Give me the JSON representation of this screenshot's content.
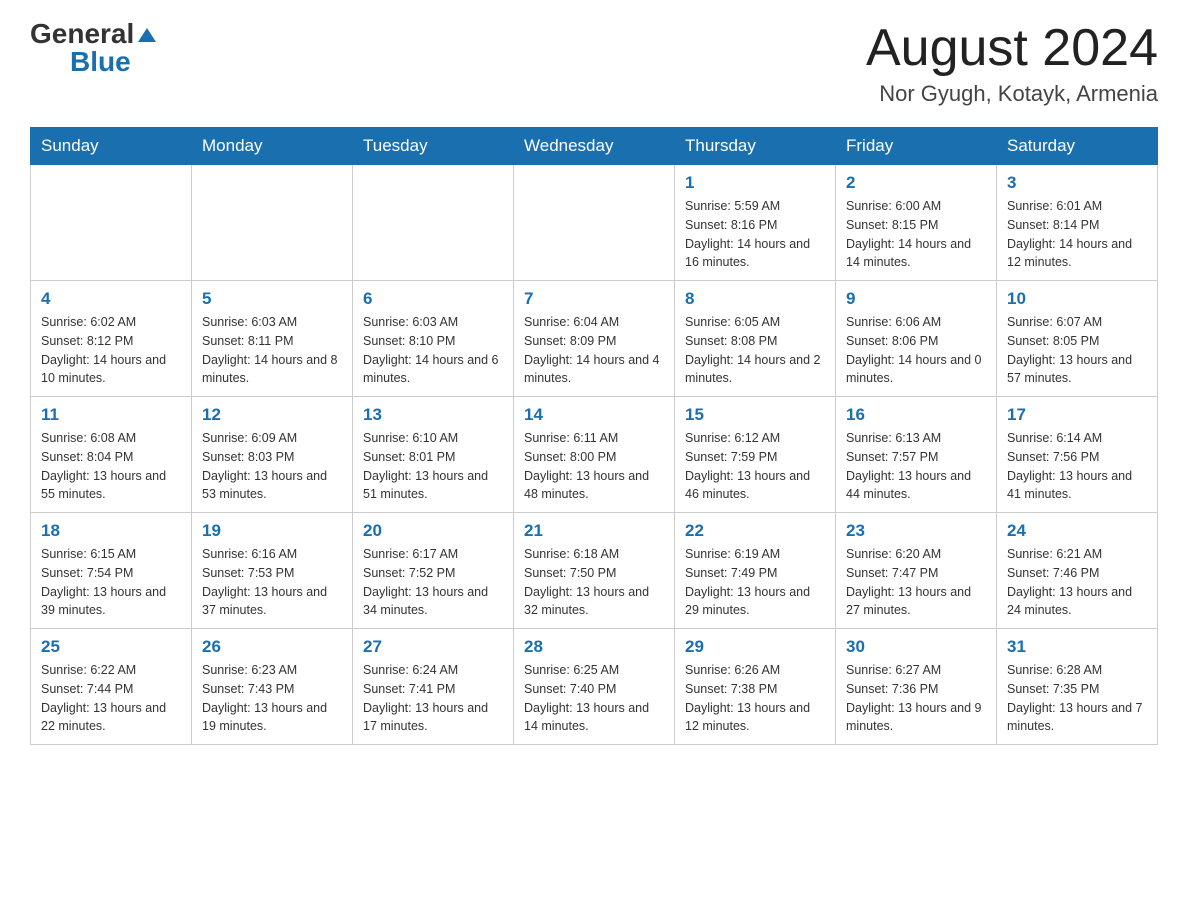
{
  "header": {
    "logo_general": "General",
    "logo_blue": "Blue",
    "month_title": "August 2024",
    "location": "Nor Gyugh, Kotayk, Armenia"
  },
  "weekdays": [
    "Sunday",
    "Monday",
    "Tuesday",
    "Wednesday",
    "Thursday",
    "Friday",
    "Saturday"
  ],
  "weeks": [
    [
      {
        "day": "",
        "info": ""
      },
      {
        "day": "",
        "info": ""
      },
      {
        "day": "",
        "info": ""
      },
      {
        "day": "",
        "info": ""
      },
      {
        "day": "1",
        "info": "Sunrise: 5:59 AM\nSunset: 8:16 PM\nDaylight: 14 hours and 16 minutes."
      },
      {
        "day": "2",
        "info": "Sunrise: 6:00 AM\nSunset: 8:15 PM\nDaylight: 14 hours and 14 minutes."
      },
      {
        "day": "3",
        "info": "Sunrise: 6:01 AM\nSunset: 8:14 PM\nDaylight: 14 hours and 12 minutes."
      }
    ],
    [
      {
        "day": "4",
        "info": "Sunrise: 6:02 AM\nSunset: 8:12 PM\nDaylight: 14 hours and 10 minutes."
      },
      {
        "day": "5",
        "info": "Sunrise: 6:03 AM\nSunset: 8:11 PM\nDaylight: 14 hours and 8 minutes."
      },
      {
        "day": "6",
        "info": "Sunrise: 6:03 AM\nSunset: 8:10 PM\nDaylight: 14 hours and 6 minutes."
      },
      {
        "day": "7",
        "info": "Sunrise: 6:04 AM\nSunset: 8:09 PM\nDaylight: 14 hours and 4 minutes."
      },
      {
        "day": "8",
        "info": "Sunrise: 6:05 AM\nSunset: 8:08 PM\nDaylight: 14 hours and 2 minutes."
      },
      {
        "day": "9",
        "info": "Sunrise: 6:06 AM\nSunset: 8:06 PM\nDaylight: 14 hours and 0 minutes."
      },
      {
        "day": "10",
        "info": "Sunrise: 6:07 AM\nSunset: 8:05 PM\nDaylight: 13 hours and 57 minutes."
      }
    ],
    [
      {
        "day": "11",
        "info": "Sunrise: 6:08 AM\nSunset: 8:04 PM\nDaylight: 13 hours and 55 minutes."
      },
      {
        "day": "12",
        "info": "Sunrise: 6:09 AM\nSunset: 8:03 PM\nDaylight: 13 hours and 53 minutes."
      },
      {
        "day": "13",
        "info": "Sunrise: 6:10 AM\nSunset: 8:01 PM\nDaylight: 13 hours and 51 minutes."
      },
      {
        "day": "14",
        "info": "Sunrise: 6:11 AM\nSunset: 8:00 PM\nDaylight: 13 hours and 48 minutes."
      },
      {
        "day": "15",
        "info": "Sunrise: 6:12 AM\nSunset: 7:59 PM\nDaylight: 13 hours and 46 minutes."
      },
      {
        "day": "16",
        "info": "Sunrise: 6:13 AM\nSunset: 7:57 PM\nDaylight: 13 hours and 44 minutes."
      },
      {
        "day": "17",
        "info": "Sunrise: 6:14 AM\nSunset: 7:56 PM\nDaylight: 13 hours and 41 minutes."
      }
    ],
    [
      {
        "day": "18",
        "info": "Sunrise: 6:15 AM\nSunset: 7:54 PM\nDaylight: 13 hours and 39 minutes."
      },
      {
        "day": "19",
        "info": "Sunrise: 6:16 AM\nSunset: 7:53 PM\nDaylight: 13 hours and 37 minutes."
      },
      {
        "day": "20",
        "info": "Sunrise: 6:17 AM\nSunset: 7:52 PM\nDaylight: 13 hours and 34 minutes."
      },
      {
        "day": "21",
        "info": "Sunrise: 6:18 AM\nSunset: 7:50 PM\nDaylight: 13 hours and 32 minutes."
      },
      {
        "day": "22",
        "info": "Sunrise: 6:19 AM\nSunset: 7:49 PM\nDaylight: 13 hours and 29 minutes."
      },
      {
        "day": "23",
        "info": "Sunrise: 6:20 AM\nSunset: 7:47 PM\nDaylight: 13 hours and 27 minutes."
      },
      {
        "day": "24",
        "info": "Sunrise: 6:21 AM\nSunset: 7:46 PM\nDaylight: 13 hours and 24 minutes."
      }
    ],
    [
      {
        "day": "25",
        "info": "Sunrise: 6:22 AM\nSunset: 7:44 PM\nDaylight: 13 hours and 22 minutes."
      },
      {
        "day": "26",
        "info": "Sunrise: 6:23 AM\nSunset: 7:43 PM\nDaylight: 13 hours and 19 minutes."
      },
      {
        "day": "27",
        "info": "Sunrise: 6:24 AM\nSunset: 7:41 PM\nDaylight: 13 hours and 17 minutes."
      },
      {
        "day": "28",
        "info": "Sunrise: 6:25 AM\nSunset: 7:40 PM\nDaylight: 13 hours and 14 minutes."
      },
      {
        "day": "29",
        "info": "Sunrise: 6:26 AM\nSunset: 7:38 PM\nDaylight: 13 hours and 12 minutes."
      },
      {
        "day": "30",
        "info": "Sunrise: 6:27 AM\nSunset: 7:36 PM\nDaylight: 13 hours and 9 minutes."
      },
      {
        "day": "31",
        "info": "Sunrise: 6:28 AM\nSunset: 7:35 PM\nDaylight: 13 hours and 7 minutes."
      }
    ]
  ]
}
